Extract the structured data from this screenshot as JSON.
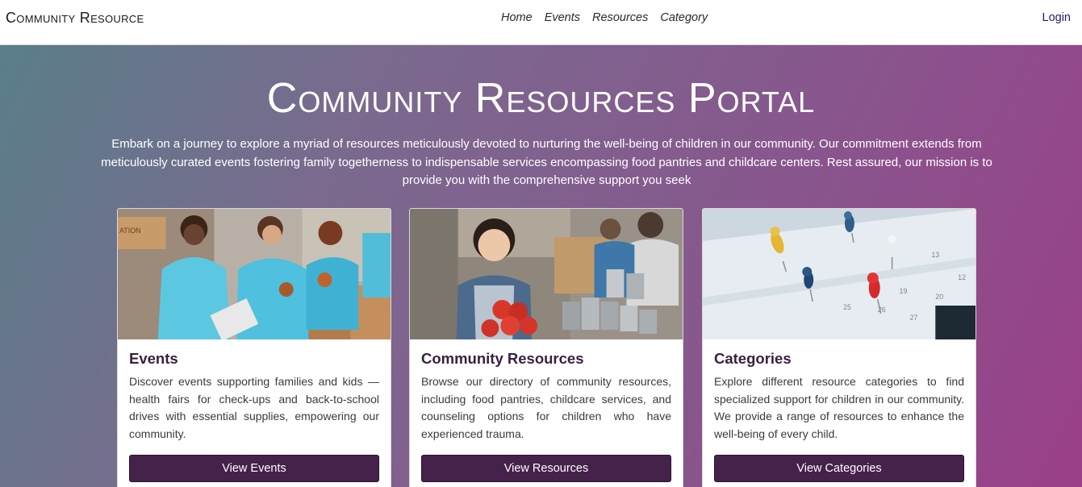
{
  "nav": {
    "brand": "Community Resource",
    "links": [
      "Home",
      "Events",
      "Resources",
      "Category"
    ],
    "login": "Login"
  },
  "hero": {
    "title": "Community Resources Portal",
    "description": "Embark on a journey to explore a myriad of resources meticulously devoted to nurturing the well-being of children in our community. Our commitment extends from meticulously curated events fostering family togetherness to indispensable services encompassing food pantries and childcare centers. Rest assured, our mission is to provide you with the comprehensive support you seek"
  },
  "cards": [
    {
      "title": "Events",
      "text": "Discover events supporting families and kids — health fairs for check-ups and back-to-school drives with essential supplies, empowering our community.",
      "button": "View Events",
      "image_label": "ATION"
    },
    {
      "title": "Community Resources",
      "text": "Browse our directory of community resources, including food pantries, childcare services, and counseling options for children who have experienced trauma.",
      "button": "View Resources"
    },
    {
      "title": "Categories",
      "text": "Explore different resource categories to find specialized support for children in our community. We provide a range of resources to enhance the well-being of every child.",
      "button": "View Categories",
      "calendar_numbers": [
        "13",
        "12",
        "19",
        "20",
        "25",
        "27",
        "26"
      ]
    }
  ],
  "colors": {
    "button_bg": "#45224a",
    "card_title": "#3a1f3e",
    "hero_gradient_start": "#5a7e8a",
    "hero_gradient_end": "#9a3f88"
  }
}
